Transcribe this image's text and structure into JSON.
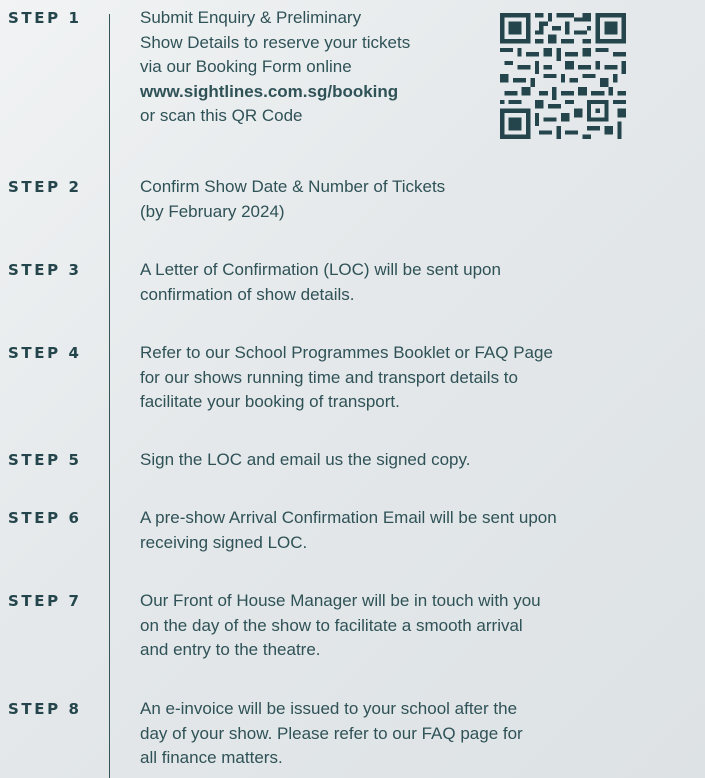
{
  "steps": [
    {
      "label": "STEP 1",
      "lines": [
        "Submit Enquiry & Preliminary",
        "Show Details to reserve your tickets",
        "via our Booking Form online",
        "www.sightlines.com.sg/booking",
        "or scan this QR Code"
      ]
    },
    {
      "label": "STEP 2",
      "lines": [
        "Confirm Show Date & Number of Tickets",
        "(by February 2024)"
      ]
    },
    {
      "label": "STEP 3",
      "lines": [
        "A Letter of Confirmation (LOC) will be sent upon",
        "confirmation of show details."
      ]
    },
    {
      "label": "STEP 4",
      "lines": [
        "Refer to our School Programmes Booklet or FAQ Page",
        "for our shows running time and transport details to",
        "facilitate your booking of transport."
      ]
    },
    {
      "label": "STEP 5",
      "lines": [
        "Sign the LOC and email us the signed copy."
      ]
    },
    {
      "label": "STEP 6",
      "lines": [
        "A pre-show Arrival Confirmation Email will be sent upon",
        "receiving signed LOC."
      ]
    },
    {
      "label": "STEP 7",
      "lines": [
        "Our Front of House Manager will be in touch with you",
        "on the day of the show to facilitate a smooth arrival",
        "and entry to the theatre."
      ]
    },
    {
      "label": "STEP 8",
      "lines": [
        "An e-invoice will be issued to your school after the",
        "day of your show. Please refer to our FAQ page for",
        "all finance matters."
      ]
    }
  ],
  "colors": {
    "text": "#2f5257",
    "label": "#23454b",
    "divider": "#35545a",
    "qr": "#23454b"
  }
}
